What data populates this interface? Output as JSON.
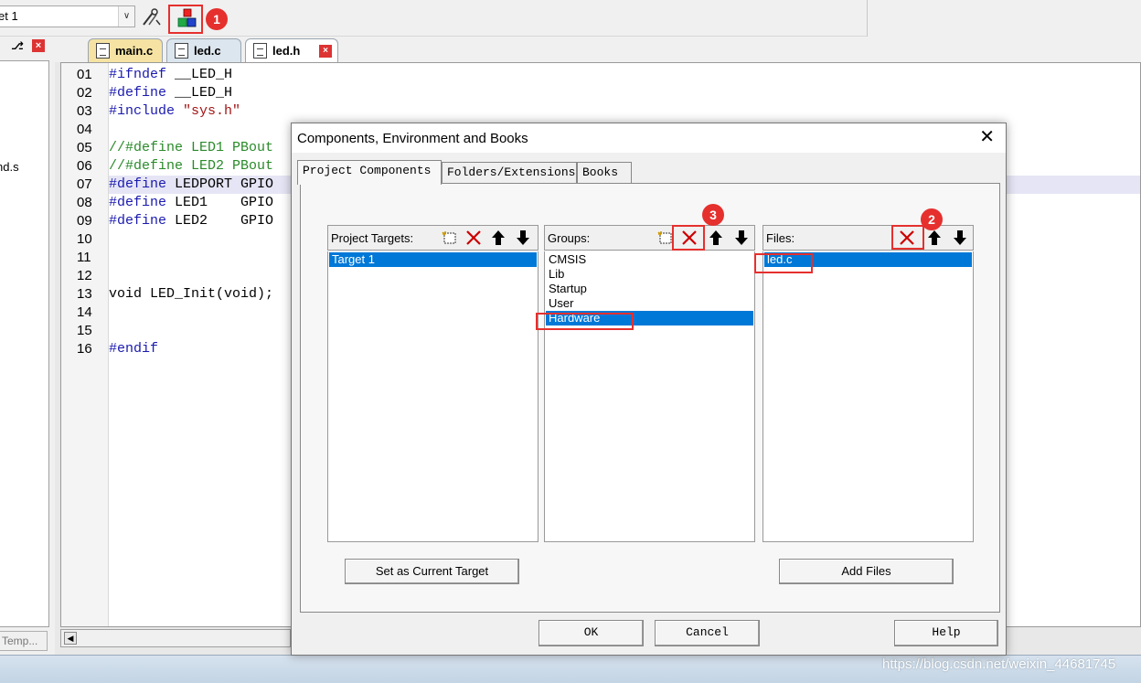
{
  "toolbar": {
    "target_value": "et 1",
    "annotation_1": "1"
  },
  "left_panel": {
    "item": "nd.s",
    "tab_label": "Temp..."
  },
  "editor": {
    "tabs": [
      {
        "label": "main.c"
      },
      {
        "label": "led.c"
      },
      {
        "label": "led.h"
      }
    ],
    "lines": [
      {
        "n": "01",
        "parts": [
          {
            "c": "kw",
            "t": "#ifndef"
          },
          {
            "c": "id",
            "t": " __LED_H"
          }
        ]
      },
      {
        "n": "02",
        "parts": [
          {
            "c": "kw",
            "t": "#define"
          },
          {
            "c": "id",
            "t": " __LED_H"
          }
        ]
      },
      {
        "n": "03",
        "parts": [
          {
            "c": "kw",
            "t": "#include"
          },
          {
            "c": "str",
            "t": " \"sys.h\""
          }
        ]
      },
      {
        "n": "04",
        "parts": []
      },
      {
        "n": "05",
        "parts": [
          {
            "c": "cmt",
            "t": "//#define LED1 PBout"
          }
        ]
      },
      {
        "n": "06",
        "parts": [
          {
            "c": "cmt",
            "t": "//#define LED2 PBout"
          }
        ]
      },
      {
        "n": "07",
        "parts": [
          {
            "c": "kw",
            "t": "#define"
          },
          {
            "c": "id",
            "t": " LEDPORT GPIO"
          }
        ]
      },
      {
        "n": "08",
        "parts": [
          {
            "c": "kw",
            "t": "#define"
          },
          {
            "c": "id",
            "t": " LED1    GPIO"
          }
        ]
      },
      {
        "n": "09",
        "parts": [
          {
            "c": "kw",
            "t": "#define"
          },
          {
            "c": "id",
            "t": " LED2    GPIO"
          }
        ]
      },
      {
        "n": "10",
        "parts": []
      },
      {
        "n": "11",
        "parts": []
      },
      {
        "n": "12",
        "parts": []
      },
      {
        "n": "13",
        "parts": [
          {
            "c": "id",
            "t": "void LED_Init(void);"
          }
        ]
      },
      {
        "n": "14",
        "parts": []
      },
      {
        "n": "15",
        "parts": []
      },
      {
        "n": "16",
        "parts": [
          {
            "c": "kw",
            "t": "#endif"
          }
        ]
      }
    ]
  },
  "dialog": {
    "title": "Components, Environment and Books",
    "tabs": [
      "Project Components",
      "Folders/Extensions",
      "Books"
    ],
    "targets": {
      "label": "Project Targets:",
      "items": [
        "Target 1"
      ],
      "selected": 0
    },
    "groups": {
      "label": "Groups:",
      "items": [
        "CMSIS",
        "Lib",
        "Startup",
        "User",
        "Hardware"
      ],
      "selected": 4,
      "annotation": "3"
    },
    "files": {
      "label": "Files:",
      "items": [
        "led.c"
      ],
      "selected": 0,
      "annotation": "2"
    },
    "buttons": {
      "set_current": "Set as Current Target",
      "add_files": "Add Files",
      "ok": "OK",
      "cancel": "Cancel",
      "help": "Help"
    }
  },
  "watermark": "https://blog.csdn.net/weixin_44681745",
  "colors": {
    "selection": "#0078d7",
    "annotation_red": "#e5302e",
    "keyword": "#1a1ab0",
    "comment": "#2a8a2a",
    "string": "#a31515"
  }
}
